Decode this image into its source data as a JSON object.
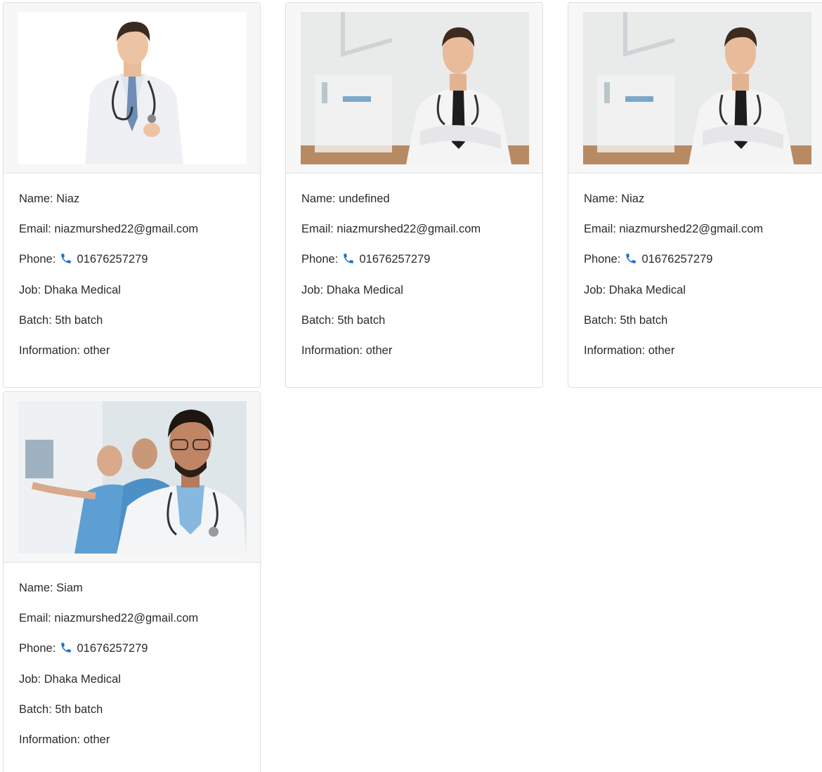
{
  "colors": {
    "phone_icon": "#1a73c8",
    "text": "#2b2b2b",
    "card_border": "#dfdfdf",
    "image_bg": "#f7f7f7"
  },
  "cards": [
    {
      "name": "Name: Niaz",
      "email": "Email: niazmurshed22@gmail.com",
      "phone_label": "Phone:",
      "phone": "01676257279",
      "job": "Job: Dhaka Medical",
      "batch": "Batch: 5th batch",
      "info": "Information: other"
    },
    {
      "name": "Name: undefined",
      "email": "Email: niazmurshed22@gmail.com",
      "phone_label": "Phone:",
      "phone": "01676257279",
      "job": "Job: Dhaka Medical",
      "batch": "Batch: 5th batch",
      "info": "Information: other"
    },
    {
      "name": "Name: Niaz",
      "email": "Email: niazmurshed22@gmail.com",
      "phone_label": "Phone:",
      "phone": "01676257279",
      "job": "Job: Dhaka Medical",
      "batch": "Batch: 5th batch",
      "info": "Information: other"
    },
    {
      "name": "Name: Siam",
      "email": "Email: niazmurshed22@gmail.com",
      "phone_label": "Phone:",
      "phone": "01676257279",
      "job": "Job: Dhaka Medical",
      "batch": "Batch: 5th batch",
      "info": "Information: other"
    }
  ],
  "icons": {
    "phone": "phone-icon"
  }
}
